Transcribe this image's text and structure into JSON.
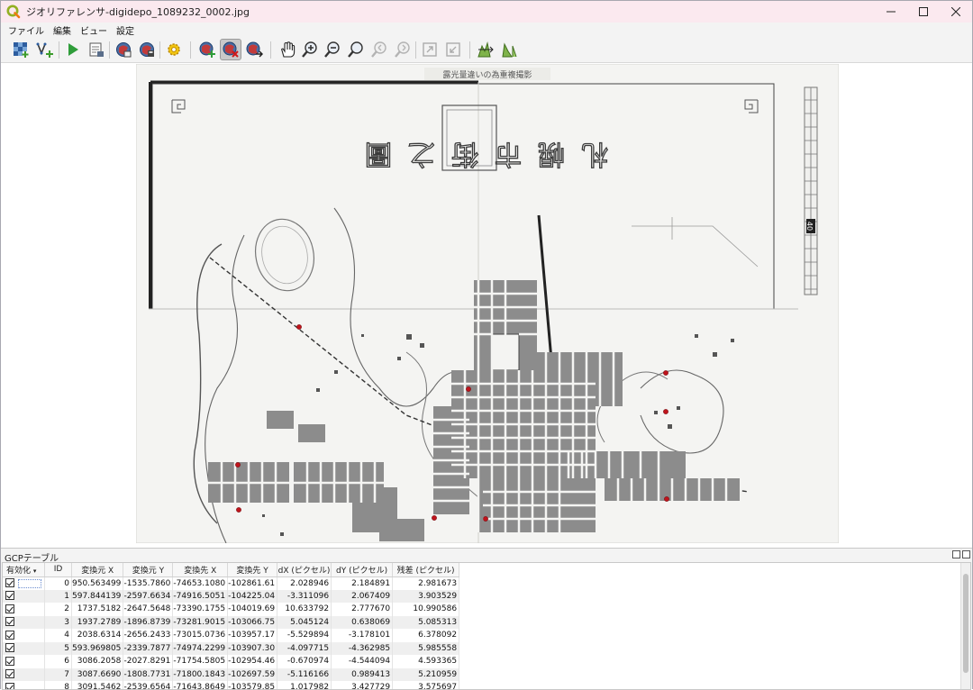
{
  "window": {
    "title": "ジオリファレンサ-digidepo_1089232_0002.jpg"
  },
  "menu": [
    "ファイル",
    "編集",
    "ビュー",
    "設定"
  ],
  "toolbar": {
    "icons": [
      "add-raster-icon",
      "add-vector-icon",
      "start-georeferencing-icon",
      "generate-gdal-script-icon",
      "load-gcp-icon",
      "save-gcp-icon",
      "transformation-settings-icon",
      "add-point-icon",
      "delete-point-icon",
      "move-point-icon",
      "pan-icon",
      "zoom-in-icon",
      "zoom-out-icon",
      "zoom-full-icon",
      "zoom-last-icon",
      "zoom-next-icon",
      "link-georef-to-qgis-icon",
      "link-qgis-to-georef-icon",
      "full-histogram-stretch-icon",
      "local-histogram-stretch-icon"
    ],
    "active_icon": "delete-point-icon"
  },
  "map": {
    "banner": "露光量違いの為重複撮影",
    "title_glyphs": "札幌市街之圖",
    "scale_label": "40",
    "colors": {
      "paper": "#f4f4f2",
      "ink": "#3a3a3a",
      "block": "#8c8c8c",
      "gcp_point": "#c0141c"
    }
  },
  "gcp": {
    "panel_title": "GCPテーブル",
    "columns": [
      "有効化",
      "ID",
      "変換元 X",
      "変換元 Y",
      "変換先 X",
      "変換先 Y",
      "dX (ピクセル)",
      "dY (ピクセル)",
      "残差 (ピクセル)"
    ],
    "rows": [
      {
        "id": "0",
        "src_x": "950.563499",
        "src_y": "-1535.7860",
        "dst_x": "-74653.1080",
        "dst_y": "-102861.61",
        "dx": "2.028946",
        "dy": "2.184891",
        "res": "2.981673"
      },
      {
        "id": "1",
        "src_x": "597.844139",
        "src_y": "-2597.6634",
        "dst_x": "-74916.5051",
        "dst_y": "-104225.04",
        "dx": "-3.311096",
        "dy": "2.067409",
        "res": "3.903529"
      },
      {
        "id": "2",
        "src_x": "1737.5182",
        "src_y": "-2647.5648",
        "dst_x": "-73390.1755",
        "dst_y": "-104019.69",
        "dx": "10.633792",
        "dy": "2.777670",
        "res": "10.990586"
      },
      {
        "id": "3",
        "src_x": "1937.2789",
        "src_y": "-1896.8739",
        "dst_x": "-73281.9015",
        "dst_y": "-103066.75",
        "dx": "5.045124",
        "dy": "0.638069",
        "res": "5.085313"
      },
      {
        "id": "4",
        "src_x": "2038.6314",
        "src_y": "-2656.2433",
        "dst_x": "-73015.0736",
        "dst_y": "-103957.17",
        "dx": "-5.529894",
        "dy": "-3.178101",
        "res": "6.378092"
      },
      {
        "id": "5",
        "src_x": "593.969805",
        "src_y": "-2339.7877",
        "dst_x": "-74974.2299",
        "dst_y": "-103907.30",
        "dx": "-4.097715",
        "dy": "-4.362985",
        "res": "5.985558"
      },
      {
        "id": "6",
        "src_x": "3086.2058",
        "src_y": "-2027.8291",
        "dst_x": "-71754.5805",
        "dst_y": "-102954.46",
        "dx": "-0.670974",
        "dy": "-4.544094",
        "res": "4.593365"
      },
      {
        "id": "7",
        "src_x": "3087.6690",
        "src_y": "-1808.7731",
        "dst_x": "-71800.1843",
        "dst_y": "-102697.59",
        "dx": "-5.116166",
        "dy": "0.989413",
        "res": "5.210959"
      },
      {
        "id": "8",
        "src_x": "3091.5462",
        "src_y": "-2539.6564",
        "dst_x": "-71643.8649",
        "dst_y": "-103579.85",
        "dx": "1.017982",
        "dy": "3.427729",
        "res": "3.575697"
      }
    ]
  }
}
